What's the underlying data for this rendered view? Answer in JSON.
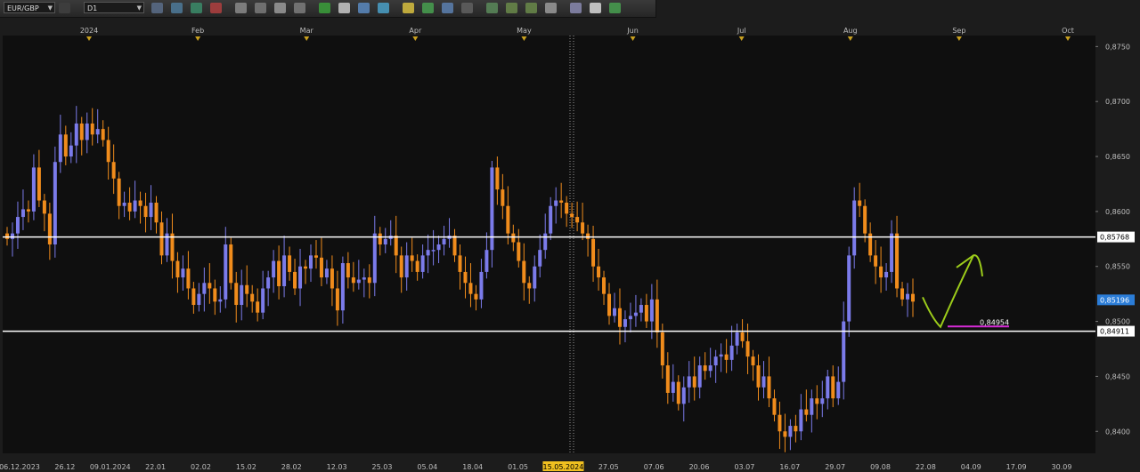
{
  "toolbar": {
    "symbol": "EUR/GBP",
    "timeframe": "D1",
    "tools": [
      "chart-type-icon",
      "crosshair-icon",
      "line-icon",
      "hline-icon",
      "zoom-in-icon",
      "zoom-out-icon",
      "cursor-icon",
      "dot-icon",
      "text-icon",
      "template-icon",
      "save-icon",
      "globe-icon",
      "pencil-icon",
      "indicator-icon",
      "calendar-icon",
      "fibonacci-icon",
      "grid-icon",
      "trendline-icon",
      "arrow-icon",
      "circle-icon",
      "rectangle-icon",
      "eraser-icon",
      "more-icon"
    ]
  },
  "colors": {
    "background": "#0f0f0f",
    "bull": "#7b7bea",
    "bear": "#f08c1c",
    "level_line": "#ffffff",
    "projection": "#9ccc1a",
    "target_line": "#d62bd6",
    "price_badge": "#2b7dd8"
  },
  "chart_data": {
    "type": "candlestick",
    "symbol": "EUR/GBP",
    "timeframe": "D1",
    "ylim": [
      0.838,
      0.876
    ],
    "y_ticks": [
      "0,8400",
      "0,8450",
      "0,8500",
      "0,8550",
      "0,8600",
      "0,8650",
      "0,8700",
      "0,8750"
    ],
    "x_date_labels": [
      "06.12.2023",
      "26.12",
      "09.01.2024",
      "22.01",
      "02.02",
      "15.02",
      "28.02",
      "12.03",
      "25.03",
      "05.04",
      "18.04",
      "01.05",
      "15.05.2024",
      "27.05",
      "07.06",
      "20.06",
      "03.07",
      "16.07",
      "29.07",
      "09.08",
      "22.08",
      "04.09",
      "17.09",
      "30.09"
    ],
    "month_labels": [
      "2024",
      "Feb",
      "Mar",
      "Apr",
      "May",
      "Jun",
      "Jul",
      "Aug",
      "Sep",
      "Oct"
    ],
    "horizontal_levels": [
      {
        "price": 0.85768,
        "label": "0,85768"
      },
      {
        "price": 0.84911,
        "label": "0,84911"
      }
    ],
    "target_level": {
      "price": 0.84954,
      "label": "0,84954"
    },
    "current_price": {
      "price": 0.85196,
      "label": "0,85196"
    },
    "highlighted_date": "15.05.2024",
    "closes": [
      0.8575,
      0.858,
      0.8595,
      0.8602,
      0.86,
      0.864,
      0.861,
      0.8598,
      0.857,
      0.8645,
      0.867,
      0.865,
      0.866,
      0.868,
      0.8665,
      0.868,
      0.867,
      0.8675,
      0.8665,
      0.8645,
      0.863,
      0.8605,
      0.8608,
      0.86,
      0.861,
      0.8605,
      0.8595,
      0.8608,
      0.859,
      0.856,
      0.858,
      0.8555,
      0.854,
      0.8548,
      0.853,
      0.8515,
      0.8525,
      0.8535,
      0.853,
      0.8518,
      0.852,
      0.857,
      0.8535,
      0.8515,
      0.8533,
      0.8525,
      0.8518,
      0.8508,
      0.853,
      0.854,
      0.8555,
      0.8532,
      0.856,
      0.8545,
      0.853,
      0.855,
      0.8548,
      0.856,
      0.8558,
      0.854,
      0.8548,
      0.853,
      0.851,
      0.8553,
      0.854,
      0.8535,
      0.8538,
      0.854,
      0.8535,
      0.858,
      0.857,
      0.8575,
      0.8578,
      0.856,
      0.854,
      0.856,
      0.8555,
      0.8545,
      0.856,
      0.8565,
      0.8565,
      0.857,
      0.8575,
      0.8578,
      0.856,
      0.8545,
      0.8535,
      0.8525,
      0.852,
      0.8545,
      0.8565,
      0.864,
      0.862,
      0.8605,
      0.858,
      0.8572,
      0.8555,
      0.8535,
      0.853,
      0.855,
      0.8565,
      0.858,
      0.8605,
      0.861,
      0.8608,
      0.8598,
      0.8595,
      0.859,
      0.858,
      0.8575,
      0.855,
      0.854,
      0.8525,
      0.8505,
      0.8512,
      0.8495,
      0.8502,
      0.8505,
      0.8508,
      0.8515,
      0.85,
      0.852,
      0.849,
      0.846,
      0.8435,
      0.8445,
      0.8425,
      0.844,
      0.845,
      0.844,
      0.846,
      0.8455,
      0.846,
      0.8468,
      0.847,
      0.8465,
      0.8478,
      0.849,
      0.8482,
      0.8468,
      0.846,
      0.844,
      0.845,
      0.843,
      0.8415,
      0.84,
      0.8395,
      0.8405,
      0.84,
      0.842,
      0.8415,
      0.843,
      0.8425,
      0.843,
      0.845,
      0.843,
      0.8445,
      0.85,
      0.856,
      0.861,
      0.8605,
      0.858,
      0.856,
      0.855,
      0.854,
      0.8545,
      0.858,
      0.853,
      0.852,
      0.8525,
      0.8518
    ],
    "annotations": [
      "green projection arrow: dip toward 0,84954 then rally toward ~0,8560"
    ]
  }
}
